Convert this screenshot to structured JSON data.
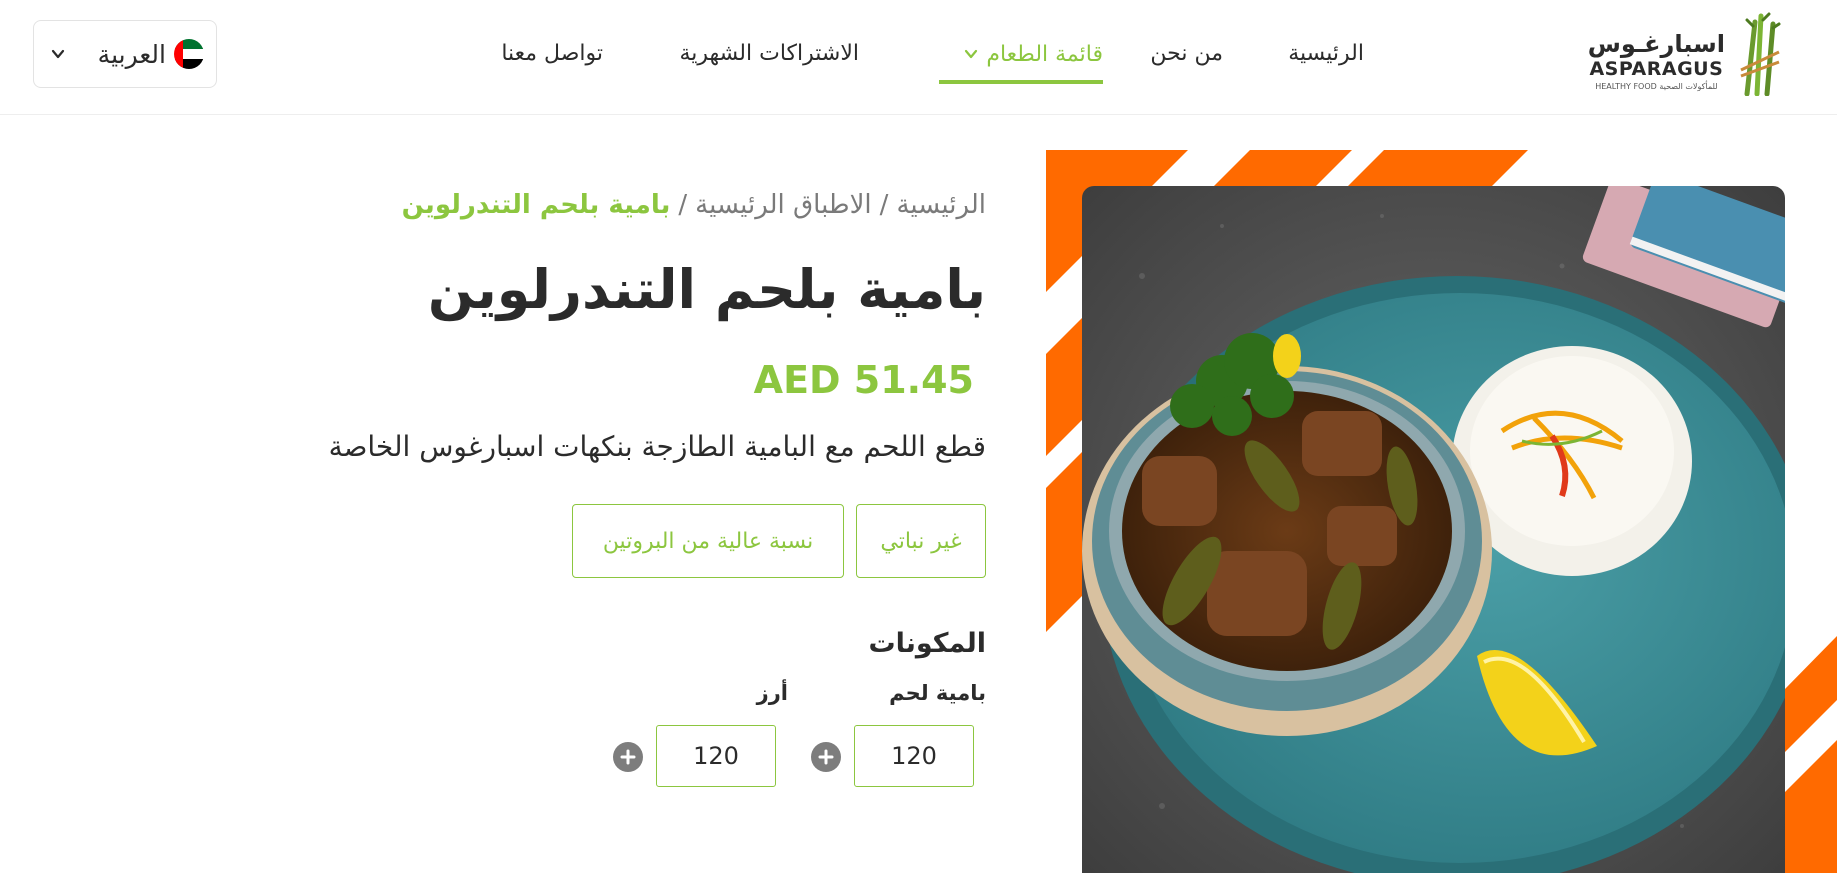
{
  "header": {
    "logo": {
      "name_ar": "اسبارغـوس",
      "name_en": "ASPARAGUS",
      "tagline_en": "HEALTHY FOOD",
      "tagline_ar": "للمأكولات الصحية"
    },
    "nav": {
      "home": "الرئيسية",
      "about": "من نحن",
      "menu": "قائمة الطعام",
      "subscriptions": "الاشتراكات الشهرية",
      "contact": "تواصل معنا"
    },
    "language": {
      "label": "العربية",
      "flag_icon": "uae-flag-icon"
    },
    "colors": {
      "accent": "#8cc63f",
      "orange": "#ff6a00"
    }
  },
  "product": {
    "breadcrumb": {
      "home": "الرئيسية",
      "separator": "/",
      "category": "الاطباق الرئيسية",
      "current": "بامية بلحم التندرلوين"
    },
    "title": "بامية بلحم التندرلوين",
    "price": "AED 51.45",
    "description": "قطع اللحم مع البامية الطازجة بنكهات اسبارغوس الخاصة",
    "tags": [
      "غير نباتي",
      "نسبة عالية من البروتين"
    ],
    "ingredients_title": "المكونات",
    "ingredients": [
      {
        "name": "بامية لحم",
        "quantity": "120"
      },
      {
        "name": "أرز",
        "quantity": "120"
      }
    ]
  }
}
